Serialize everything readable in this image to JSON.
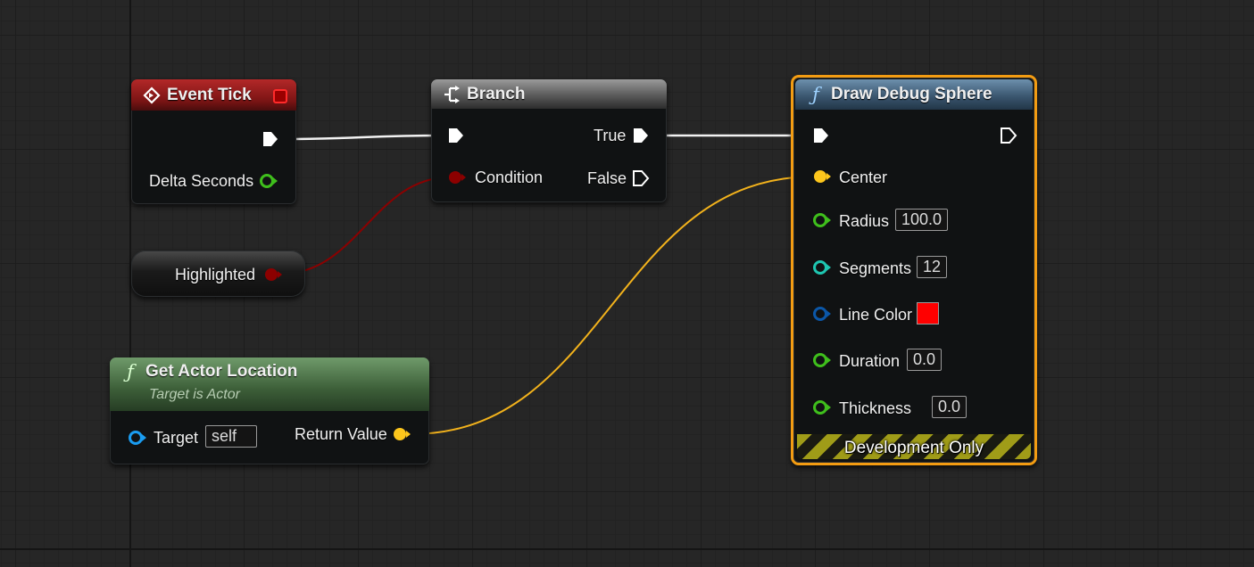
{
  "colors": {
    "exec": "#ffffff",
    "bool": "#8c0000",
    "float": "#3fbf1c",
    "vector": "#fdc61c",
    "int": "#1ec6b1",
    "struct_color": "#0b57a8",
    "object": "#1a9cf0",
    "selected_border": "#f39c12",
    "line_color_value": "#ff0000"
  },
  "nodes": {
    "event_tick": {
      "title": "Event Tick",
      "icon": "event-diamond-icon",
      "delta_seconds_label": "Delta Seconds"
    },
    "branch": {
      "title": "Branch",
      "icon": "branch-icon",
      "condition_label": "Condition",
      "true_label": "True",
      "false_label": "False"
    },
    "highlighted": {
      "label": "Highlighted"
    },
    "get_actor_location": {
      "title": "Get Actor Location",
      "subtitle": "Target is Actor",
      "icon": "function-icon",
      "target_label": "Target",
      "target_value": "self",
      "return_label": "Return Value"
    },
    "draw_debug_sphere": {
      "title": "Draw Debug Sphere",
      "icon": "function-icon",
      "center_label": "Center",
      "radius_label": "Radius",
      "radius_value": "100.0",
      "segments_label": "Segments",
      "segments_value": "12",
      "line_color_label": "Line Color",
      "duration_label": "Duration",
      "duration_value": "0.0",
      "thickness_label": "Thickness",
      "thickness_value": "0.0",
      "footer": "Development Only"
    }
  }
}
